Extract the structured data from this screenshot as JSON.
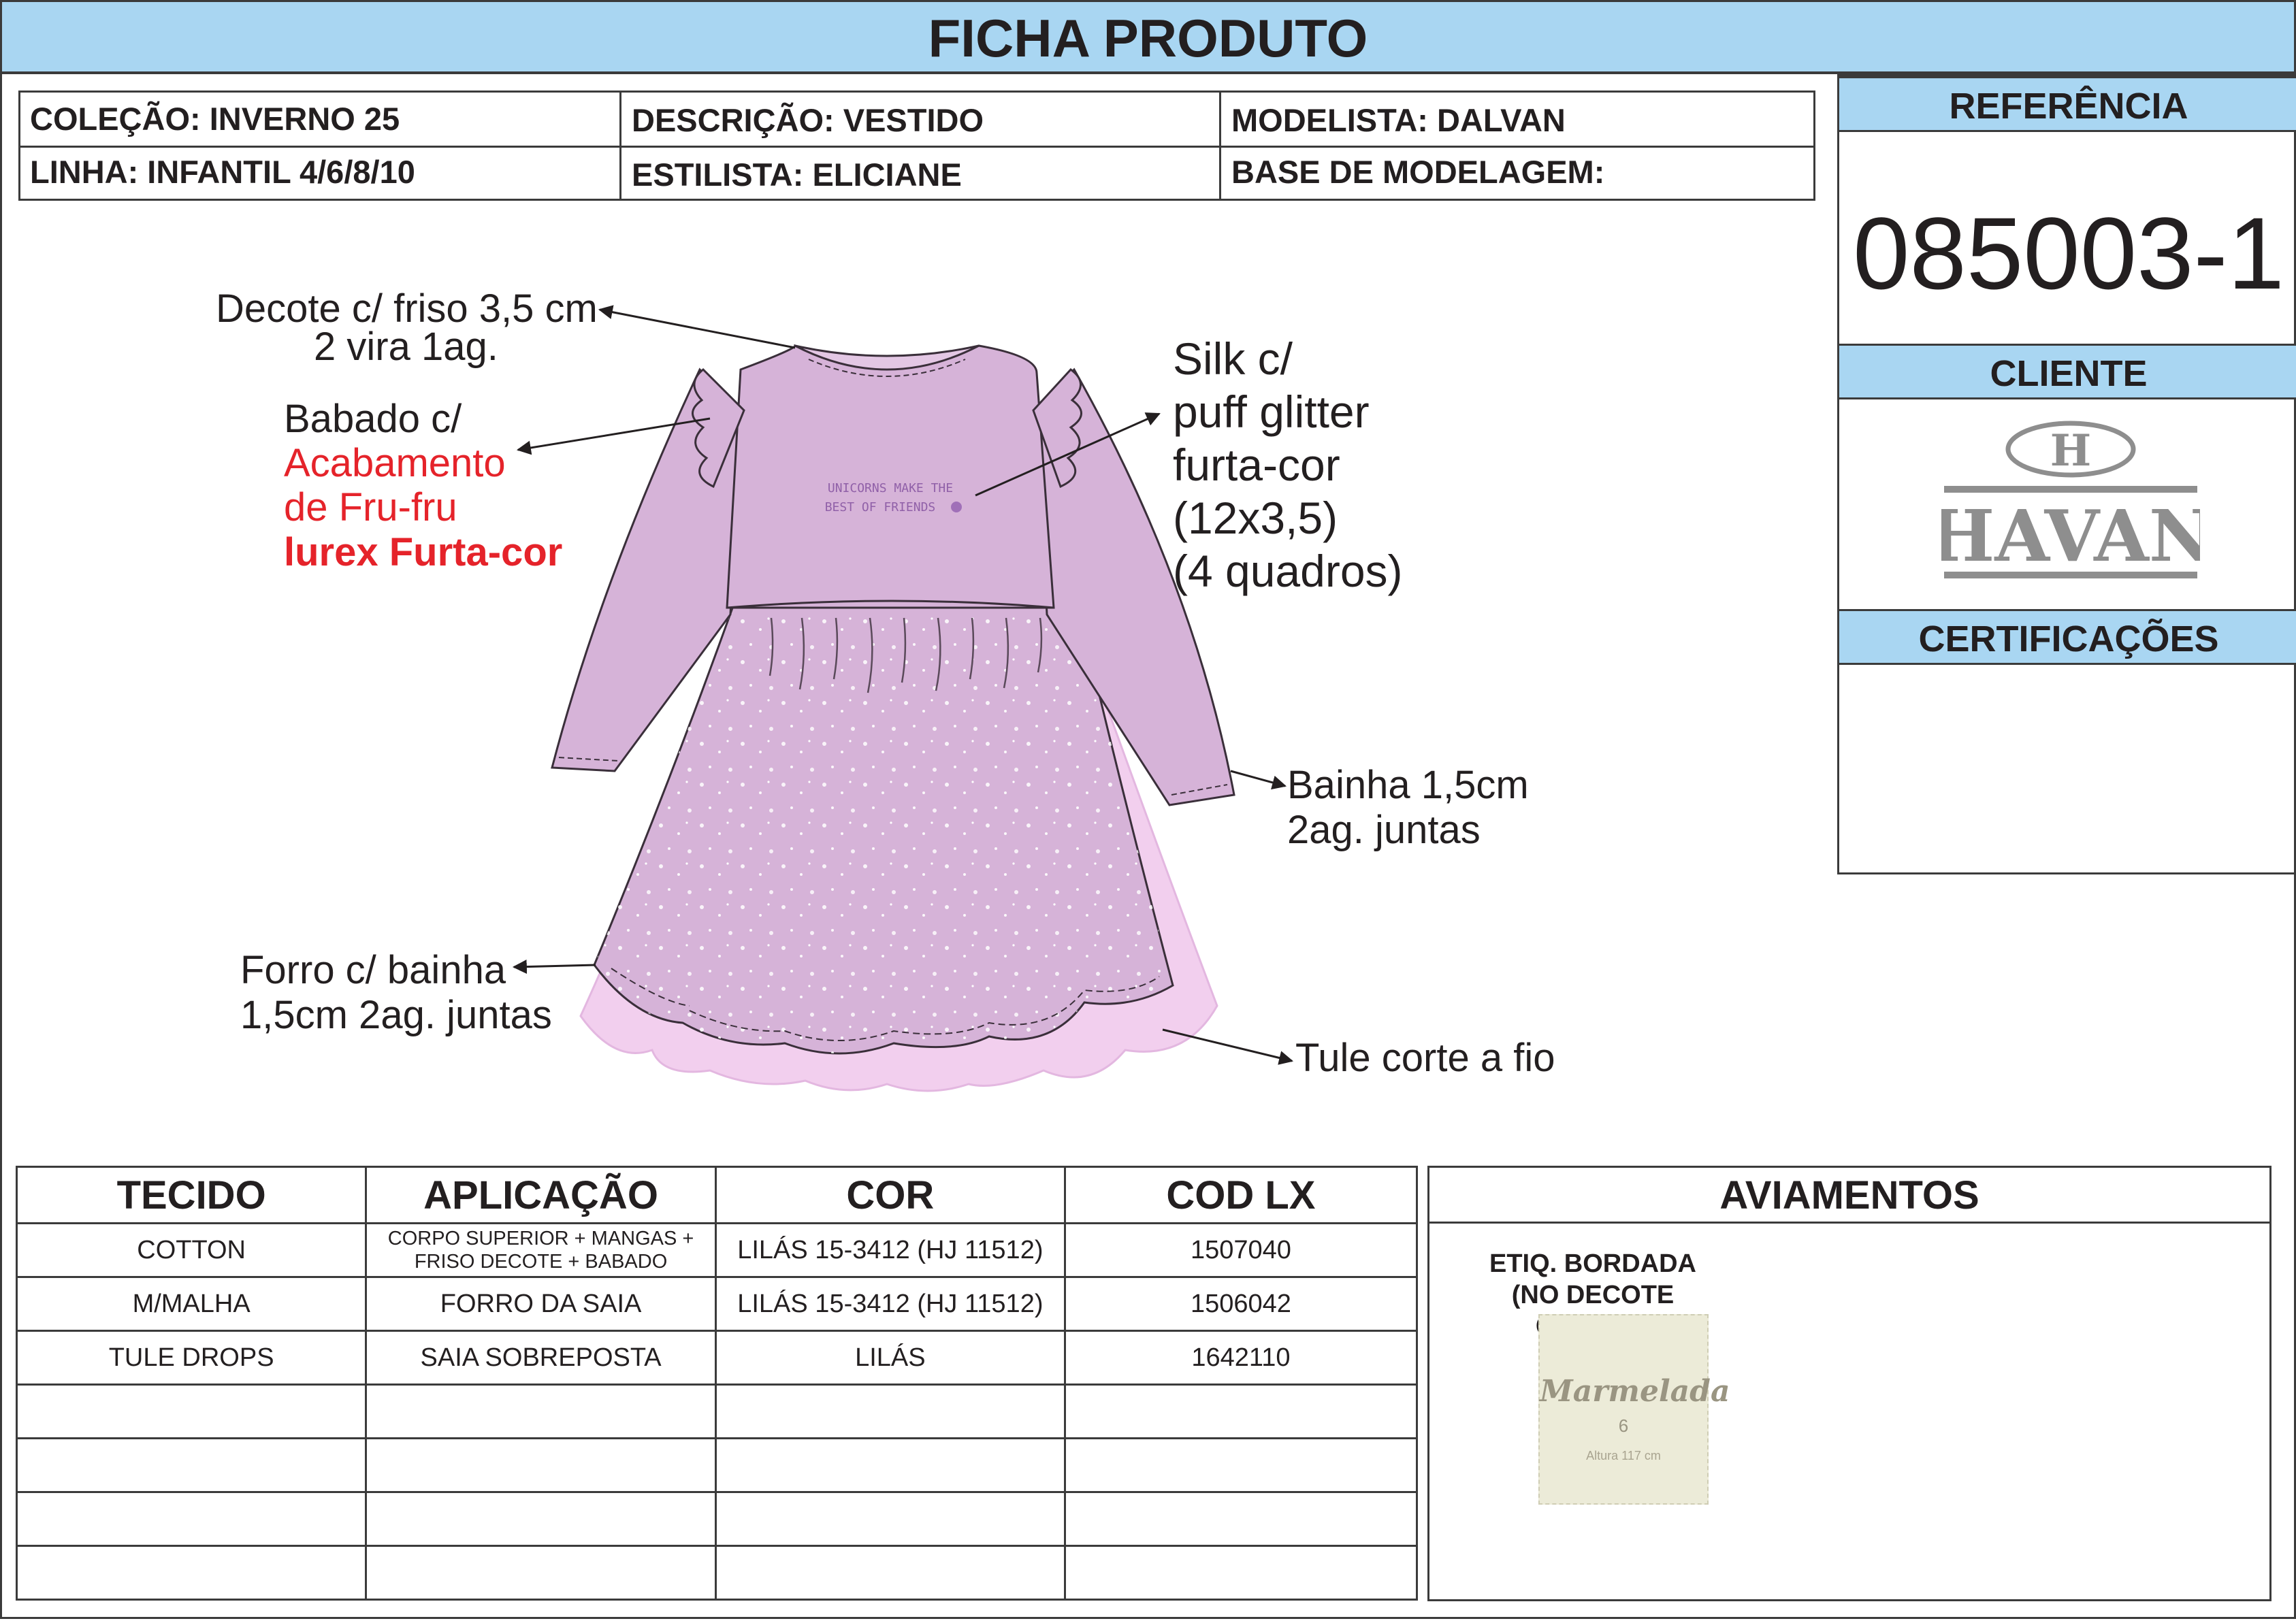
{
  "header": {
    "title": "FICHA PRODUTO"
  },
  "info": {
    "colecao": "COLEÇÃO: INVERNO 25",
    "descricao": "DESCRIÇÃO: VESTIDO",
    "modelista": "MODELISTA: DALVAN",
    "linha": "LINHA: INFANTIL 4/6/8/10",
    "estilista": "ESTILISTA: ELICIANE",
    "base": "BASE DE MODELAGEM:"
  },
  "side": {
    "referencia_label": "REFERÊNCIA",
    "referencia": "085003-1",
    "cliente_label": "CLIENTE",
    "cliente_logo_letter": "H",
    "cliente_logo_text": "HAVAN",
    "certificacoes_label": "CERTIFICAÇÕES"
  },
  "notes": {
    "decote_1": "Decote c/ friso 3,5 cm",
    "decote_2": "2 vira 1ag.",
    "babado_1": "Babado c/",
    "babado_2": "Acabamento",
    "babado_3": "de Fru-fru",
    "babado_4": "lurex Furta-cor",
    "silk_1": "Silk c/",
    "silk_2": "puff glitter",
    "silk_3": "furta-cor",
    "silk_4": "(12x3,5)",
    "silk_5": "(4 quadros)",
    "bainha_1": "Bainha 1,5cm",
    "bainha_2": "2ag. juntas",
    "forro_1": "Forro c/ bainha",
    "forro_2": "1,5cm 2ag. juntas",
    "tule": "Tule corte a fio"
  },
  "print": {
    "line1": "UNICORNS MAKE THE",
    "line2": "BEST OF FRIENDS"
  },
  "fabrics": {
    "headers": [
      "TECIDO",
      "APLICAÇÃO",
      "COR",
      "COD LX"
    ],
    "rows": [
      {
        "tecido": "COTTON",
        "aplicacao_1": "CORPO SUPERIOR + MANGAS +",
        "aplicacao_2": "FRISO DECOTE + BABADO",
        "cor": "LILÁS 15-3412 (HJ 11512)",
        "cod": "1507040"
      },
      {
        "tecido": "M/MALHA",
        "aplicacao": "FORRO DA SAIA",
        "cor": "LILÁS 15-3412 (HJ 11512)",
        "cod": "1506042"
      },
      {
        "tecido": "TULE DROPS",
        "aplicacao": "SAIA SOBREPOSTA",
        "cor": "LILÁS",
        "cod": "1642110"
      }
    ]
  },
  "aviamentos": {
    "title": "AVIAMENTOS",
    "item_line1": "ETIQ. BORDADA",
    "item_line2": "(NO DECOTE COSTAS)",
    "label_brand": "Marmelada",
    "label_size": "6",
    "label_alt": "Altura 117 cm"
  },
  "colors": {
    "header_blue": "#a9d6f2",
    "dress_lilac": "#d6b3d8",
    "tulle_pink": "#f2cfee",
    "accent_red": "#e5232a"
  }
}
